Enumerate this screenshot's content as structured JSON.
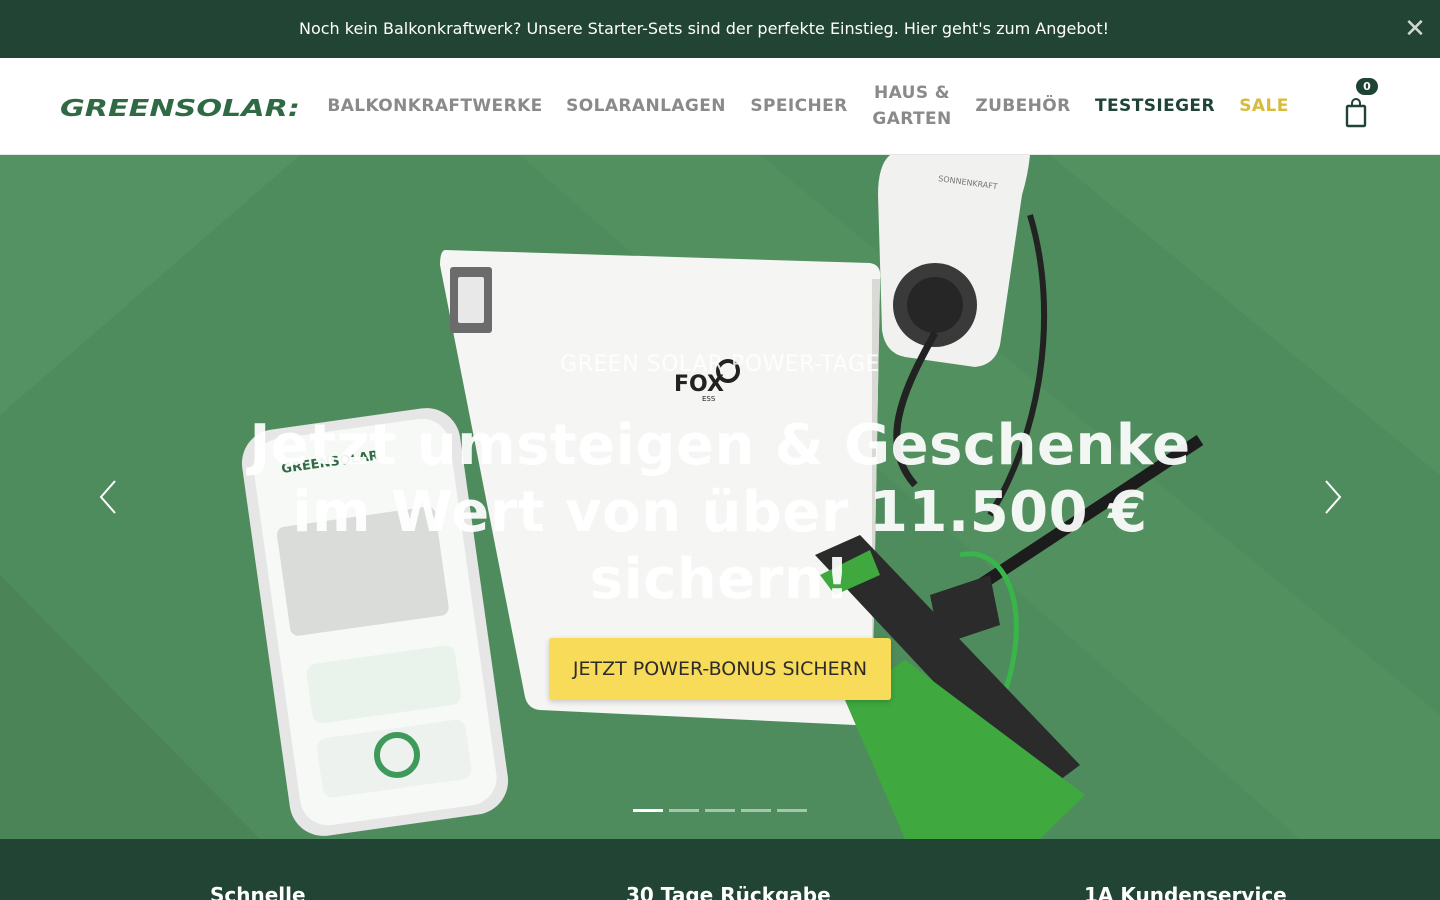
{
  "announcement": {
    "text": "Noch kein Balkonkraftwerk? Unsere Starter-Sets sind der perfekte Einstieg. Hier geht's zum Angebot!",
    "close_glyph": "✕"
  },
  "header": {
    "logo": {
      "text": "GREENSOLAR:"
    },
    "nav": [
      {
        "label": "BALKONKRAFTWERKE"
      },
      {
        "label": "SOLARANLAGEN"
      },
      {
        "label": "SPEICHER"
      },
      {
        "label": "HAUS & GARTEN"
      },
      {
        "label": "ZUBEHÖR"
      },
      {
        "label": "TESTSIEGER"
      },
      {
        "label": "SALE"
      }
    ],
    "cart": {
      "count": "0"
    }
  },
  "hero": {
    "eyebrow": "GREEN SOLAR POWER-TAGE",
    "title": "Jetzt umsteigen & Geschenke im Wert von über 11.500 € sichern!",
    "cta_label": "JETZT POWER-BONUS SICHERN",
    "slide_count": 5,
    "active_slide": 1,
    "product_text": {
      "battery_brand": "FOX",
      "battery_sub": "ESS",
      "wallbox_brand": "SONNENKRAFT",
      "app_brand": "GREENSOLAR"
    }
  },
  "features": [
    {
      "label": "Schnelle"
    },
    {
      "label": "30 Tage Rückgabe"
    },
    {
      "label": "1A Kundenservice"
    }
  ],
  "colors": {
    "dark_green": "#214434",
    "hero_green": "#4f8c5d",
    "cta_yellow": "#f7db59",
    "sale_gold": "#d7bc3b",
    "nav_grey": "#8a8a8a"
  }
}
